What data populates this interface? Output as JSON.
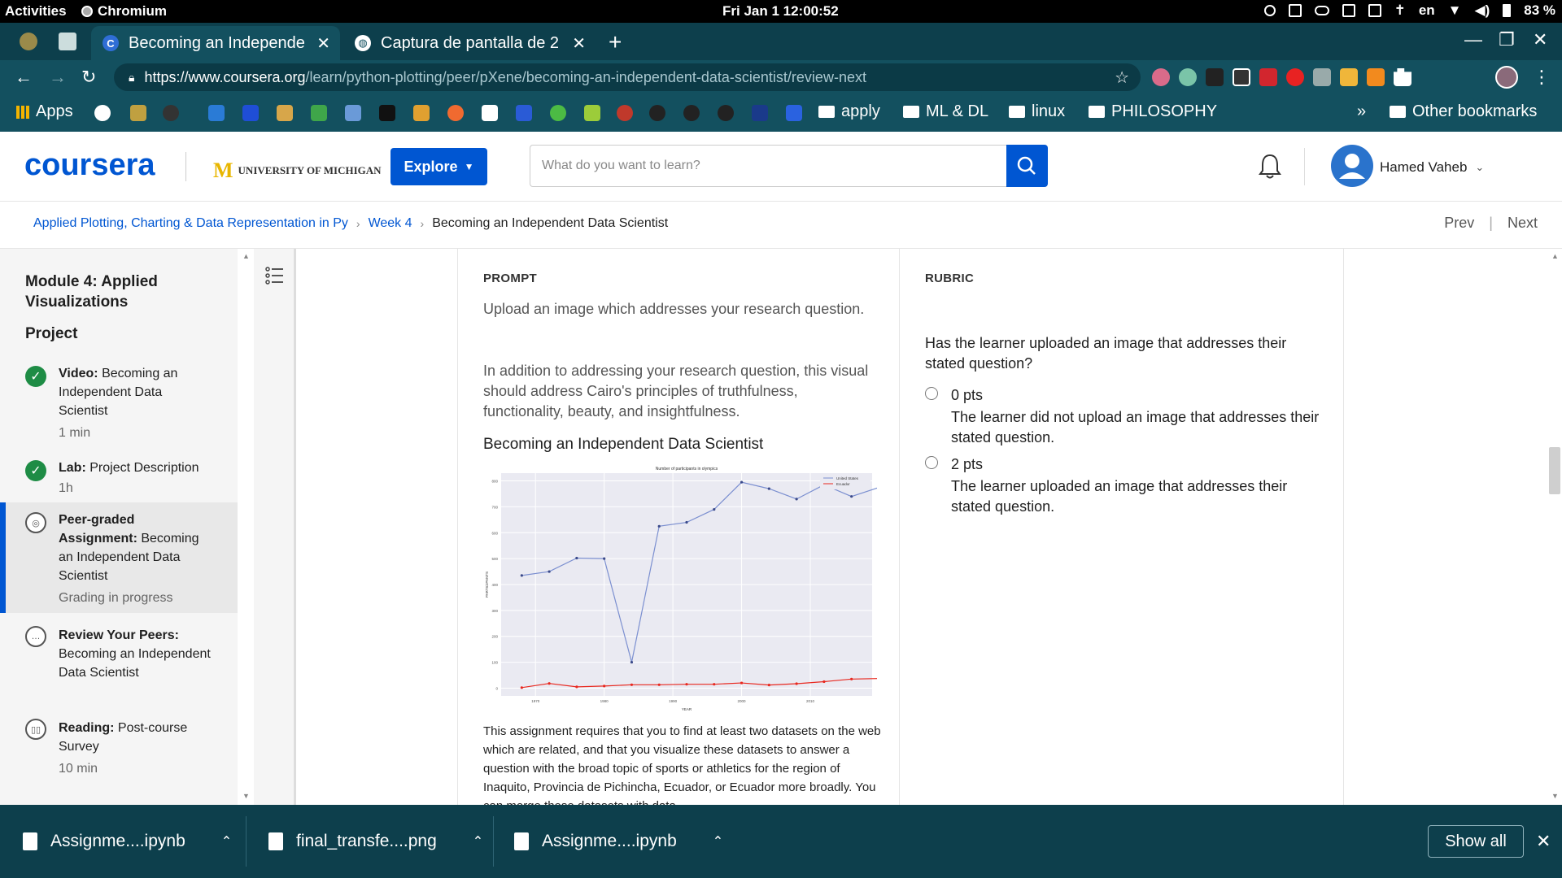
{
  "system": {
    "activities": "Activities",
    "app_name": "Chromium",
    "clock": "Fri Jan 1  12:00:52",
    "lang": "en",
    "battery": "83 %"
  },
  "tabs": [
    {
      "title": "Becoming an Independe",
      "favicon": "C"
    },
    {
      "title": "Captura de pantalla de 2",
      "favicon": "globe"
    }
  ],
  "address": {
    "host": "https://www.coursera.org",
    "path": "/learn/python-plotting/peer/pXene/becoming-an-independent-data-scientist/review-next"
  },
  "bookmarks": {
    "apps": "Apps",
    "folders": [
      "apply",
      "ML & DL",
      "linux",
      "PHILOSOPHY"
    ],
    "more": "»",
    "other": "Other bookmarks"
  },
  "header": {
    "logo": "coursera",
    "partner": "UNIVERSITY OF MICHIGAN",
    "explore": "Explore",
    "search_placeholder": "What do you want to learn?",
    "user_name": "Hamed Vaheb"
  },
  "breadcrumb": {
    "course": "Applied Plotting, Charting & Data Representation in Py",
    "week": "Week 4",
    "current": "Becoming an Independent Data Scientist",
    "prev": "Prev",
    "next": "Next"
  },
  "sidebar": {
    "module_title": "Module 4: Applied Visualizations",
    "section": "Project",
    "items": [
      {
        "kind": "Video:",
        "name": "Becoming an Independent Data Scientist",
        "meta": "1 min",
        "status": "done"
      },
      {
        "kind": "Lab:",
        "name": "Project Description",
        "meta": "1h",
        "status": "done"
      },
      {
        "kind": "Peer-graded Assignment:",
        "name": "Becoming an Independent Data Scientist",
        "meta": "Grading in progress",
        "status": "current"
      },
      {
        "kind": "Review Your Peers:",
        "name": "Becoming an Independent Data Scientist",
        "meta": "",
        "status": "todo"
      },
      {
        "kind": "Reading:",
        "name": "Post-course Survey",
        "meta": "10 min",
        "status": "todo"
      }
    ]
  },
  "prompt": {
    "heading": "PROMPT",
    "p1": "Upload an image which addresses your research question.",
    "p2": "In addition to addressing your research question, this visual should address Cairo's principles of truthfulness, functionality, beauty, and insightfulness.",
    "image_title": "Becoming an Independent Data Scientist",
    "description": "This assignment requires that you to find at least two datasets on the web which are related, and that you visualize these datasets to answer a question with the broad topic of sports or athletics for the region of Inaquito, Provincia de Pichincha, Ecuador, or Ecuador more broadly. You can merge these datasets with data"
  },
  "rubric": {
    "heading": "RUBRIC",
    "question": "Has the learner uploaded an image that addresses their stated question?",
    "options": [
      {
        "pts": "0 pts",
        "text": "The learner did not upload an image that addresses their stated question."
      },
      {
        "pts": "2 pts",
        "text": "The learner uploaded an image that addresses their stated question."
      }
    ]
  },
  "downloads": {
    "files": [
      "Assignme....ipynb",
      "final_transfe....png",
      "Assignme....ipynb"
    ],
    "show_all": "Show all"
  },
  "chart_data": {
    "type": "line",
    "title": "Number of participants in olympics",
    "xlabel": "YEAR",
    "ylabel": "PARTICIPANTS",
    "x": [
      1968,
      1972,
      1976,
      1980,
      1984,
      1988,
      1992,
      1996,
      2000,
      2004,
      2008,
      2012,
      2016
    ],
    "x_ticks": [
      1970,
      1980,
      1990,
      2000,
      2010
    ],
    "y_ticks": [
      0,
      100,
      200,
      300,
      400,
      500,
      600,
      700,
      800
    ],
    "ylim": [
      -30,
      830
    ],
    "xlim": [
      1965,
      2019
    ],
    "legend_position": "top-right",
    "grid": true,
    "series": [
      {
        "name": "United States",
        "color": "#7b8fd0",
        "values": [
          435,
          450,
          502,
          500,
          100,
          625,
          640,
          690,
          795,
          770,
          730,
          785,
          740,
          775
        ]
      },
      {
        "name": "Ecuador",
        "color": "#e8281f",
        "values": [
          2,
          18,
          5,
          8,
          13,
          13,
          15,
          15,
          20,
          12,
          17,
          25,
          35,
          37
        ]
      }
    ],
    "x_full": [
      1968,
      1972,
      1976,
      1980,
      1984,
      1988,
      1992,
      1996,
      2000,
      2004,
      2008,
      2012,
      2016,
      2020
    ]
  }
}
